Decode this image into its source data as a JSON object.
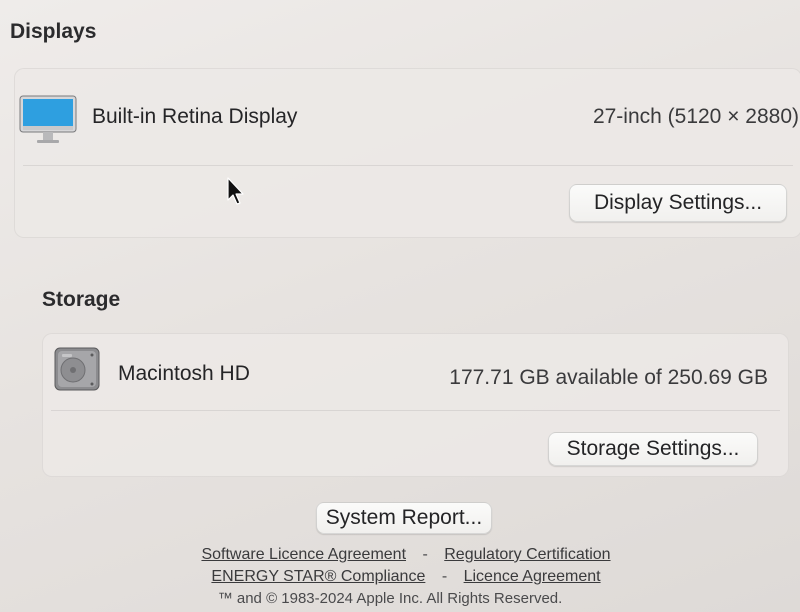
{
  "displays": {
    "section_title": "Displays",
    "items": [
      {
        "icon": "imac-display-icon",
        "name": "Built-in Retina Display",
        "detail": "27-inch (5120 × 2880)"
      }
    ],
    "settings_button": "Display Settings..."
  },
  "storage": {
    "section_title": "Storage",
    "items": [
      {
        "icon": "hard-drive-icon",
        "name": "Macintosh HD",
        "detail": "177.71 GB available of 250.69 GB"
      }
    ],
    "settings_button": "Storage Settings..."
  },
  "system_report_button": "System Report...",
  "footer": {
    "line1": {
      "link1": "Software Licence Agreement",
      "separator": "-",
      "link2": "Regulatory Certification"
    },
    "line2": {
      "link1": "ENERGY STAR® Compliance",
      "separator": "-",
      "link2": "Licence Agreement"
    },
    "copyright": "™ and © 1983-2024 Apple Inc. All Rights Reserved."
  },
  "colors": {
    "background": "#e9e5e2",
    "card": "#ece9e6",
    "button": "#f8f7f6",
    "screen_blue": "#2e9fe0"
  }
}
